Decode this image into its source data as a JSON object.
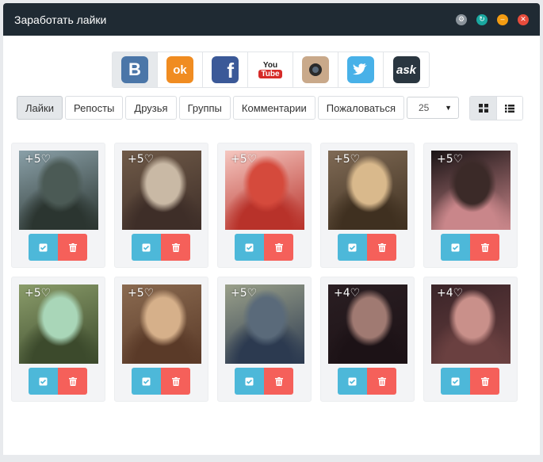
{
  "window": {
    "title": "Заработать лайки"
  },
  "social": [
    {
      "name": "vk-icon",
      "glyph": "B",
      "bg": "#4b76a8"
    },
    {
      "name": "odnoklassniki-icon",
      "glyph": "ok",
      "bg": "#f08c21"
    },
    {
      "name": "facebook-icon",
      "glyph": "f",
      "bg": "#3b5998"
    },
    {
      "name": "youtube-icon",
      "glyph": "You",
      "bg": "#d62b28"
    },
    {
      "name": "instagram-icon",
      "glyph": "",
      "bg": "#5a3a2a"
    },
    {
      "name": "twitter-icon",
      "glyph": "",
      "bg": "#48b1e8"
    },
    {
      "name": "ask-icon",
      "glyph": "ask",
      "bg": "#2a3640"
    }
  ],
  "tabs": [
    "Лайки",
    "Репосты",
    "Друзья",
    "Группы",
    "Комментарии",
    "Пожаловаться"
  ],
  "count_select": {
    "value": "25"
  },
  "cards": [
    {
      "badge": "+5♡",
      "colors": [
        "#8aa0a8",
        "#4b5a55",
        "#2b3530"
      ]
    },
    {
      "badge": "+5♡",
      "colors": [
        "#6f5a48",
        "#c9b9a5",
        "#3e2e28"
      ]
    },
    {
      "badge": "+5♡",
      "colors": [
        "#f5c7c0",
        "#d54a3c",
        "#b8322a"
      ]
    },
    {
      "badge": "+5♡",
      "colors": [
        "#7f6a55",
        "#d9b98c",
        "#3f3020"
      ]
    },
    {
      "badge": "+5♡",
      "colors": [
        "#1a1415",
        "#3b2a28",
        "#c9868a"
      ]
    },
    {
      "badge": "+5♡",
      "colors": [
        "#8a9c6a",
        "#a9d6b8",
        "#3c4a2c"
      ]
    },
    {
      "badge": "+5♡",
      "colors": [
        "#8a6a50",
        "#d6b08a",
        "#5a3a28"
      ]
    },
    {
      "badge": "+5♡",
      "colors": [
        "#9aa08a",
        "#5a6a7a",
        "#2c3a50"
      ]
    },
    {
      "badge": "+4♡",
      "colors": [
        "#2a1e22",
        "#a07a72",
        "#1c1216"
      ]
    },
    {
      "badge": "+4♡",
      "colors": [
        "#3a2428",
        "#c9908a",
        "#6a4040"
      ]
    }
  ]
}
